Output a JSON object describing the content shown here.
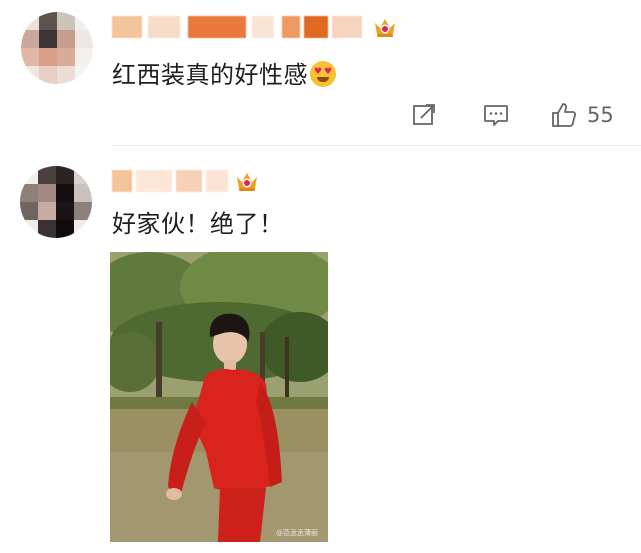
{
  "comments": [
    {
      "text": "红西装真的好性感",
      "emoji": "heart-eyes",
      "likes": "55"
    },
    {
      "text": "好家伙！绝了！",
      "image_watermark": "@范丞丞薄丽"
    }
  ],
  "colors": {
    "badge": "#f0a020",
    "like_count": "#666666",
    "suit_red": "#d9231d"
  },
  "icons": {
    "share": "share-icon",
    "comment": "comment-icon",
    "like": "thumbs-up-icon",
    "badge": "crown-badge-icon"
  }
}
